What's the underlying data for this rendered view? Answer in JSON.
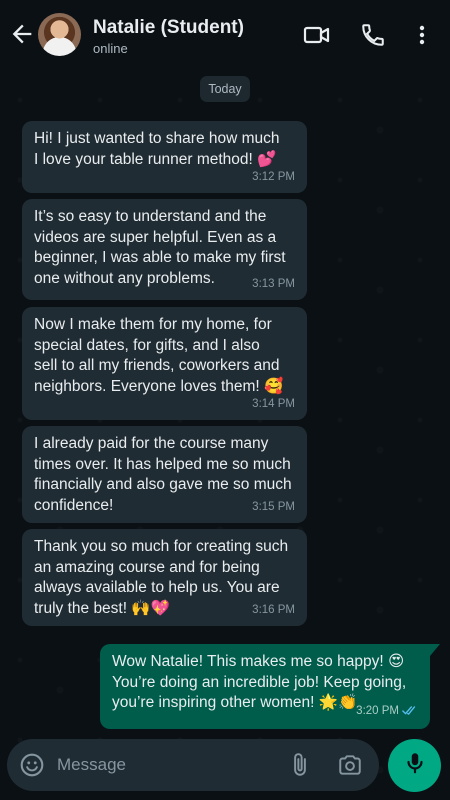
{
  "header": {
    "back_icon": "arrow-left-icon",
    "contact_name": "Natalie (Student)",
    "status": "online",
    "icons": [
      "video-call-icon",
      "phone-icon",
      "more-vertical-icon"
    ]
  },
  "day_label": "Today",
  "messages": [
    {
      "direction": "in",
      "text": "Hi! I just wanted to share how much\nI love your table runner method! 💕",
      "time": "3:12 PM"
    },
    {
      "direction": "in",
      "text": "It’s so easy to understand and the\nvideos are super helpful. Even as a\nbeginner, I was able to make my first\none without any problems.",
      "time": "3:13 PM"
    },
    {
      "direction": "in",
      "text": "Now I make them for my home, for\nspecial dates, for gifts, and I also\nsell to all my friends, coworkers and\nneighbors. Everyone loves them! 🥰",
      "time": "3:14 PM"
    },
    {
      "direction": "in",
      "text": "I already paid for the course many\ntimes over. It has helped me so much\nfinancially and also gave me so much\nconfidence!",
      "time": "3:15 PM"
    },
    {
      "direction": "in",
      "text": "Thank you so much for creating such\nan amazing course and for being\nalways available to help us. You are\ntruly the best! 🙌💖",
      "time": "3:16 PM"
    },
    {
      "direction": "out",
      "text": "Wow Natalie! This makes me so happy! 😍\nYou’re doing an incredible job! Keep going,\nyou’re inspiring other women! 🌟👏",
      "time": "3:20 PM",
      "status": "read"
    }
  ],
  "composer": {
    "placeholder": "Message",
    "icons": [
      "emoji-icon",
      "attach-icon",
      "camera-icon",
      "mic-icon"
    ]
  },
  "colors": {
    "background": "#0b1014",
    "incoming_bubble": "#202c33",
    "outgoing_bubble": "#005c4b",
    "accent": "#00a884",
    "read_ticks": "#53bdeb"
  }
}
